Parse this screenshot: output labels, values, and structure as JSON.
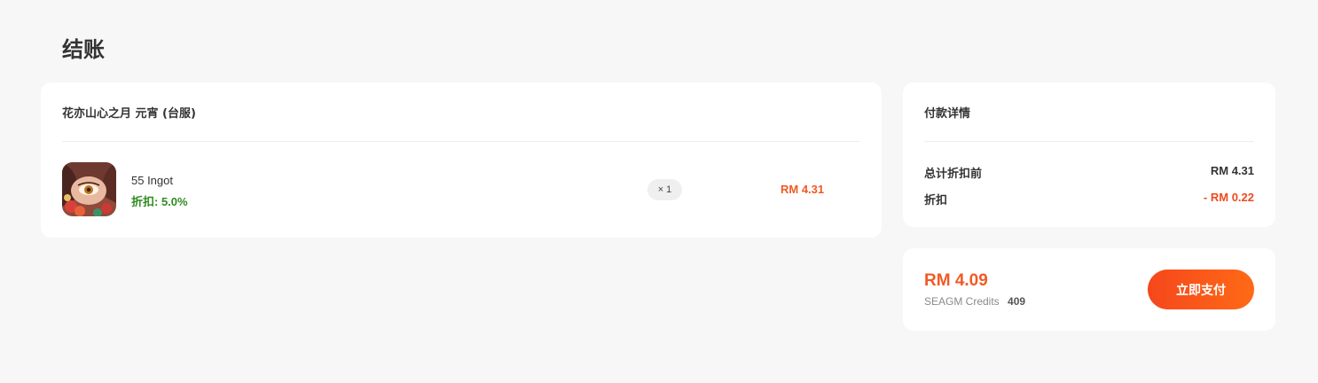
{
  "page": {
    "title": "结账"
  },
  "order": {
    "product_title": "花亦山心之月 元宵 (台服)",
    "item": {
      "name": "55 Ingot",
      "discount_text": "折扣: 5.0%",
      "quantity_text": "× 1",
      "price": "RM 4.31"
    }
  },
  "payment_details": {
    "title": "付款详情",
    "subtotal_label": "总计折扣前",
    "subtotal_value": "RM 4.31",
    "discount_label": "折扣",
    "discount_value": "- RM 0.22"
  },
  "checkout": {
    "total": "RM 4.09",
    "credits_label": "SEAGM Credits",
    "credits_value": "409",
    "pay_button_label": "立即支付"
  },
  "colors": {
    "accent": "#f15a24",
    "discount_green": "#2e8b1f",
    "background": "#f7f7f7"
  }
}
